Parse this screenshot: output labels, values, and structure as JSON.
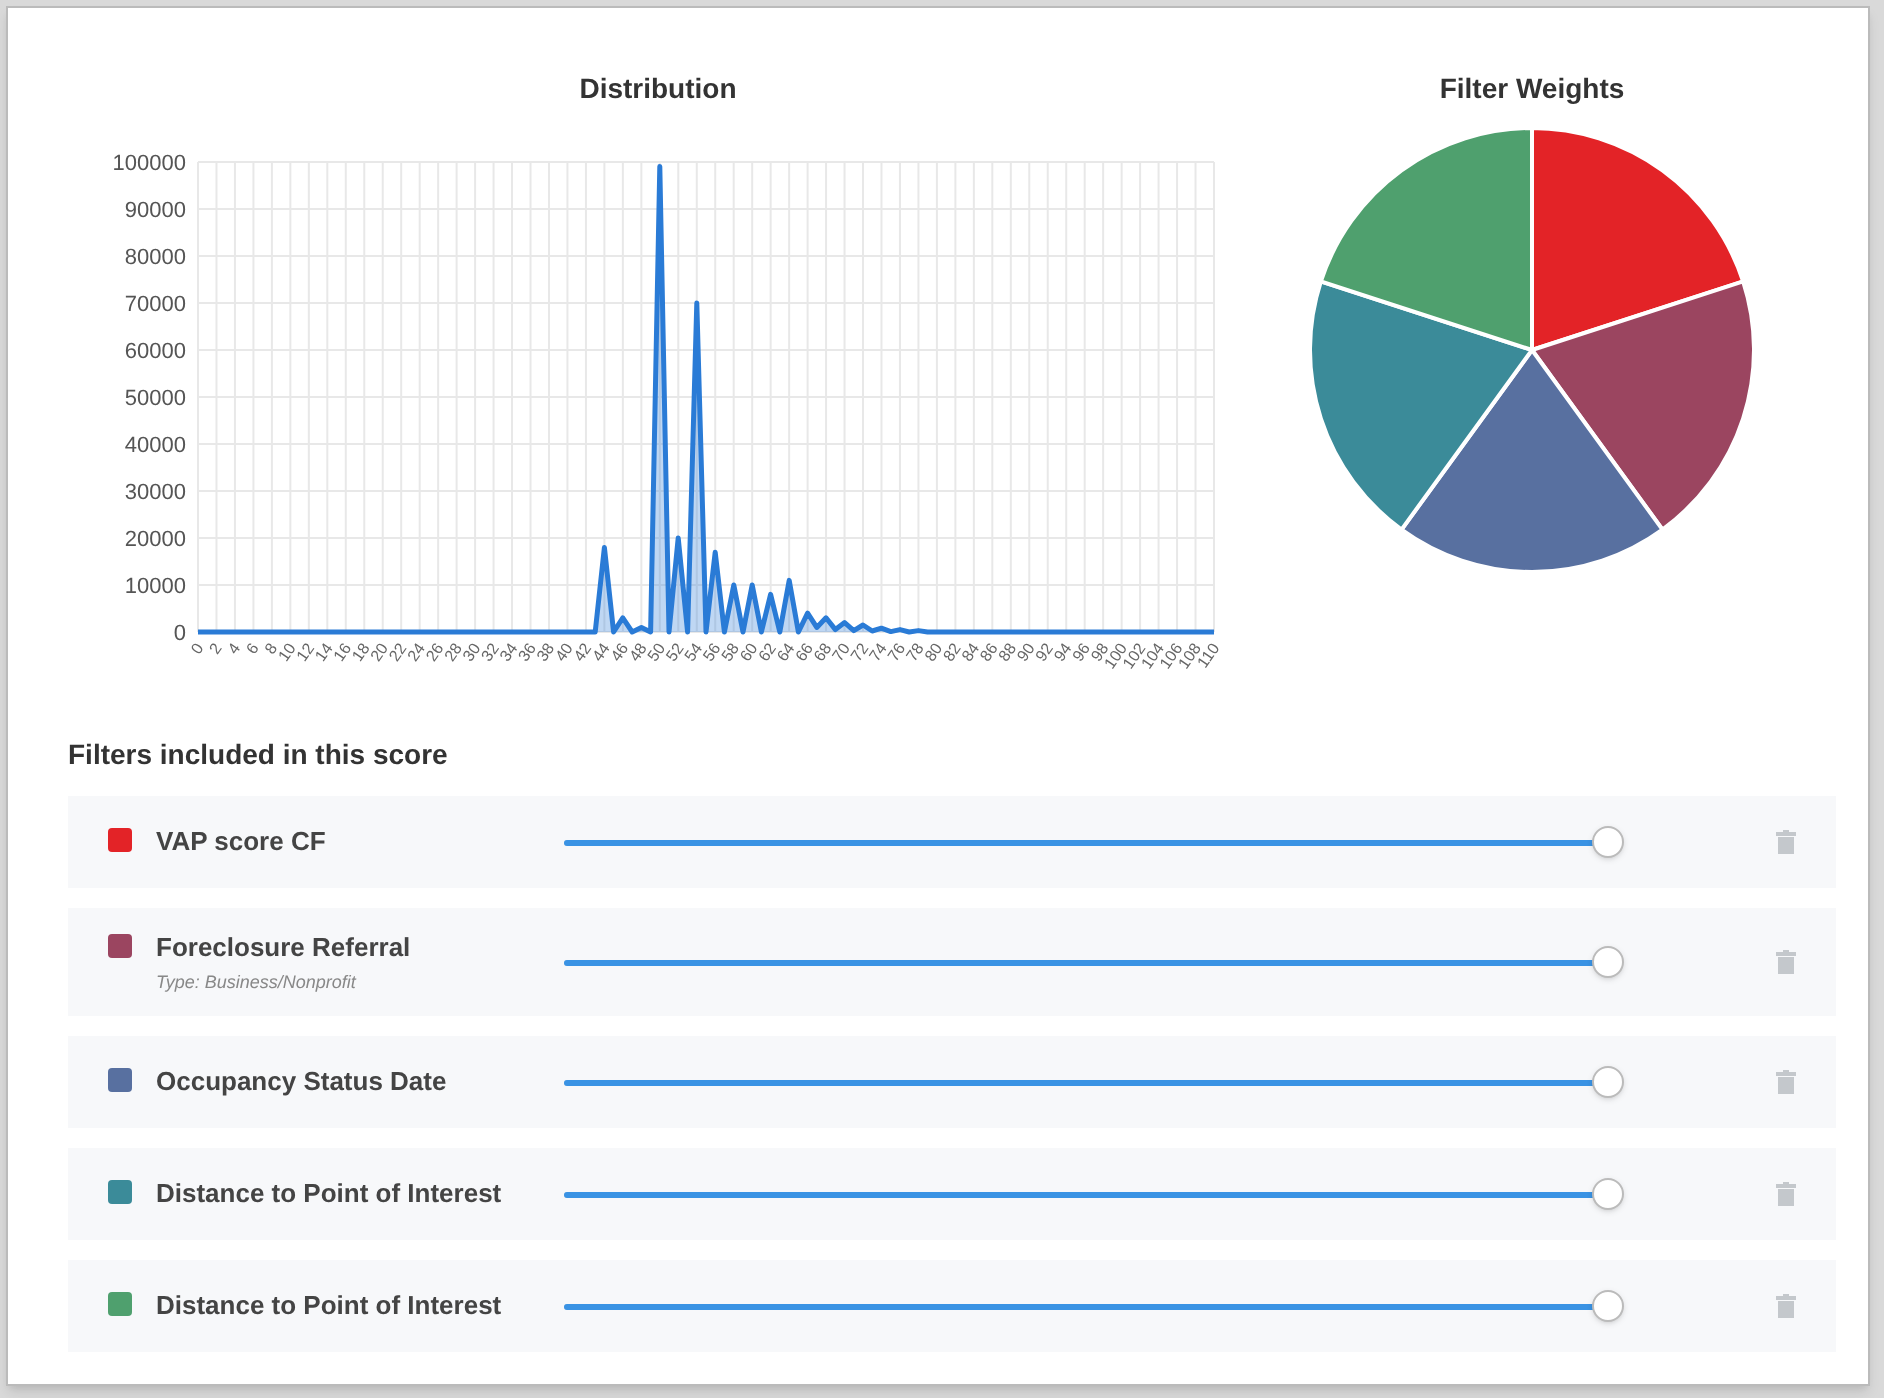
{
  "distribution": {
    "title": "Distribution",
    "chart_data": {
      "type": "area",
      "x": [
        0,
        1,
        2,
        3,
        4,
        5,
        6,
        7,
        8,
        9,
        10,
        11,
        12,
        13,
        14,
        15,
        16,
        17,
        18,
        19,
        20,
        21,
        22,
        23,
        24,
        25,
        26,
        27,
        28,
        29,
        30,
        31,
        32,
        33,
        34,
        35,
        36,
        37,
        38,
        39,
        40,
        41,
        42,
        43,
        44,
        45,
        46,
        47,
        48,
        49,
        50,
        51,
        52,
        53,
        54,
        55,
        56,
        57,
        58,
        59,
        60,
        61,
        62,
        63,
        64,
        65,
        66,
        67,
        68,
        69,
        70,
        71,
        72,
        73,
        74,
        75,
        76,
        77,
        78,
        79,
        80,
        81,
        82,
        83,
        84,
        85,
        86,
        87,
        88,
        89,
        90,
        91,
        92,
        93,
        94,
        95,
        96,
        97,
        98,
        99,
        100,
        101,
        102,
        103,
        104,
        105,
        106,
        107,
        108,
        109,
        110
      ],
      "grid": true,
      "series": [
        {
          "color": "#2a7bd6",
          "values": [
            0,
            0,
            0,
            0,
            0,
            0,
            0,
            0,
            0,
            0,
            0,
            0,
            0,
            0,
            0,
            0,
            0,
            0,
            0,
            0,
            0,
            0,
            0,
            0,
            0,
            0,
            0,
            0,
            0,
            0,
            0,
            0,
            0,
            0,
            0,
            0,
            0,
            0,
            0,
            0,
            0,
            0,
            0,
            0,
            18000,
            0,
            3000,
            0,
            1000,
            0,
            99000,
            0,
            20000,
            0,
            70000,
            0,
            17000,
            0,
            10000,
            0,
            10000,
            0,
            8000,
            0,
            11000,
            0,
            4000,
            1000,
            3000,
            500,
            2000,
            300,
            1500,
            200,
            800,
            100,
            500,
            0,
            300,
            0,
            0,
            0,
            0,
            0,
            0,
            0,
            0,
            0,
            0,
            0,
            0,
            0,
            0,
            0,
            0,
            0,
            0,
            0,
            0,
            0,
            0,
            0,
            0,
            0,
            0,
            0,
            0,
            0,
            0,
            0,
            0
          ]
        }
      ],
      "xlim": [
        0,
        110
      ],
      "ylim": [
        0,
        100000
      ],
      "xticks": [
        0,
        2,
        4,
        6,
        8,
        10,
        12,
        14,
        16,
        18,
        20,
        22,
        24,
        26,
        28,
        30,
        32,
        34,
        36,
        38,
        40,
        42,
        44,
        46,
        48,
        50,
        52,
        54,
        56,
        58,
        60,
        62,
        64,
        66,
        68,
        70,
        72,
        74,
        76,
        78,
        80,
        82,
        84,
        86,
        88,
        90,
        92,
        94,
        96,
        98,
        100,
        102,
        104,
        106,
        108,
        110
      ],
      "yticks": [
        0,
        10000,
        20000,
        30000,
        40000,
        50000,
        60000,
        70000,
        80000,
        90000,
        100000
      ]
    }
  },
  "weights": {
    "title": "Filter Weights",
    "chart_data": {
      "type": "pie",
      "values": [
        20,
        20,
        20,
        20,
        20
      ]
    }
  },
  "filters_heading": "Filters included in this score",
  "filters": [
    {
      "name": "VAP score CF",
      "color": "#e32327",
      "level": 1
    },
    {
      "name": "Foreclosure Referral",
      "subtitle": "Type: Business/Nonprofit",
      "color": "#9b4560",
      "level": 1
    },
    {
      "name": "Occupancy Status Date",
      "color": "#5870a0",
      "level": 1
    },
    {
      "name": "Distance to Point of Interest",
      "color": "#3b8b99",
      "level": 1
    },
    {
      "name": "Distance to Point of Interest",
      "color": "#4fa06e",
      "level": 1
    }
  ]
}
